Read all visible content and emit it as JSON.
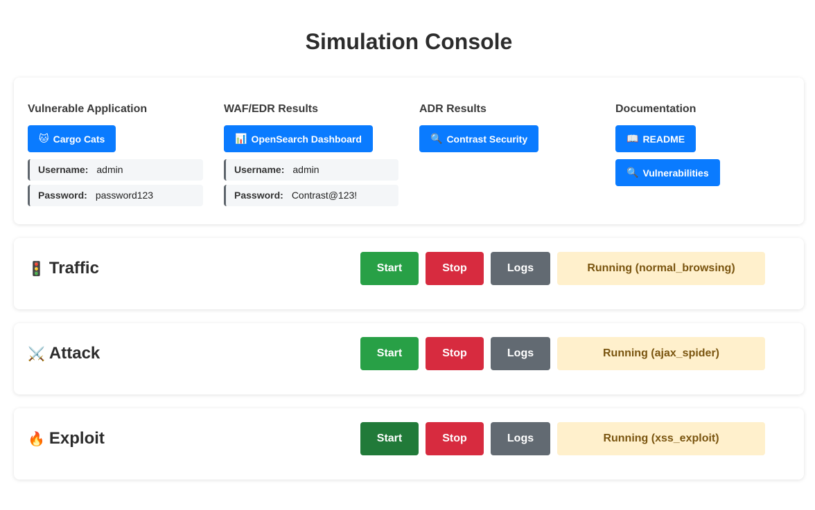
{
  "page": {
    "title": "Simulation Console"
  },
  "links": {
    "vulnerable_app": {
      "heading": "Vulnerable Application",
      "button": {
        "icon": "cat-face-icon",
        "glyph": "🐱",
        "label": "Cargo Cats"
      },
      "username_label": "Username:",
      "username": "admin",
      "password_label": "Password:",
      "password": "password123"
    },
    "waf_edr": {
      "heading": "WAF/EDR Results",
      "button": {
        "icon": "bar-chart-icon",
        "glyph": "📊",
        "label": "OpenSearch Dashboard"
      },
      "username_label": "Username:",
      "username": "admin",
      "password_label": "Password:",
      "password": "Contrast@123!"
    },
    "adr": {
      "heading": "ADR Results",
      "button": {
        "icon": "magnifier-icon",
        "glyph": "🔍",
        "label": "Contrast Security"
      }
    },
    "documentation": {
      "heading": "Documentation",
      "readme": {
        "icon": "open-book-icon",
        "glyph": "📖",
        "label": "README"
      },
      "vulnerabilities": {
        "icon": "magnifier-icon",
        "glyph": "🔍",
        "label": "Vulnerabilities"
      }
    }
  },
  "simulations": [
    {
      "icon": "traffic-light-icon",
      "glyph": "🚦",
      "name": "Traffic",
      "start_label": "Start",
      "stop_label": "Stop",
      "logs_label": "Logs",
      "status": "Running (normal_browsing)"
    },
    {
      "icon": "crossed-swords-icon",
      "glyph": "⚔️",
      "name": "Attack",
      "start_label": "Start",
      "stop_label": "Stop",
      "logs_label": "Logs",
      "status": "Running (ajax_spider)"
    },
    {
      "icon": "fire-icon",
      "glyph": "🔥",
      "name": "Exploit",
      "start_label": "Start",
      "stop_label": "Stop",
      "logs_label": "Logs",
      "status": "Running (xss_exploit)"
    }
  ],
  "colors": {
    "primary": "#0a7bff",
    "start": "#28a046",
    "start_active": "#217a39",
    "stop": "#d72b3f",
    "logs": "#626a72",
    "status_bg": "#fff0cc",
    "status_text": "#7a5510"
  }
}
